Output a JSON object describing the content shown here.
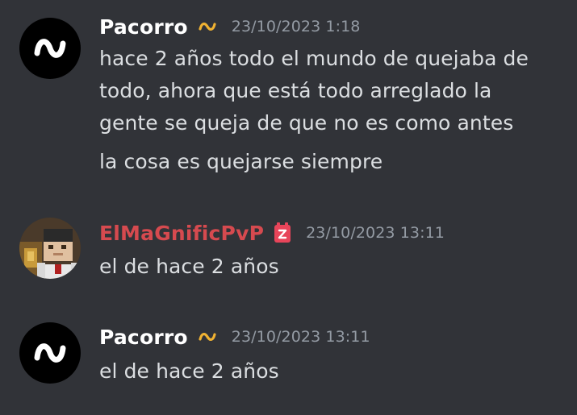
{
  "messages": [
    {
      "username": "Pacorro",
      "username_color": "#ffffff",
      "badge_icon": "wave-icon",
      "timestamp": "23/10/2023 1:18",
      "lines": [
        "hace 2 años todo el mundo de quejaba de",
        "todo, ahora que está todo arreglado la",
        "gente se queja de que no es como antes",
        "la cosa es quejarse siempre"
      ]
    },
    {
      "username": "ElMaGnificPvP",
      "username_color": "#d64a4f",
      "badge_icon": "role-badge-icon",
      "timestamp": "23/10/2023 13:11",
      "lines": [
        "el de hace 2 años"
      ]
    },
    {
      "username": "Pacorro",
      "username_color": "#ffffff",
      "badge_icon": "wave-icon",
      "timestamp": "23/10/2023 13:11",
      "lines": [
        "el de hace 2 años"
      ]
    }
  ]
}
